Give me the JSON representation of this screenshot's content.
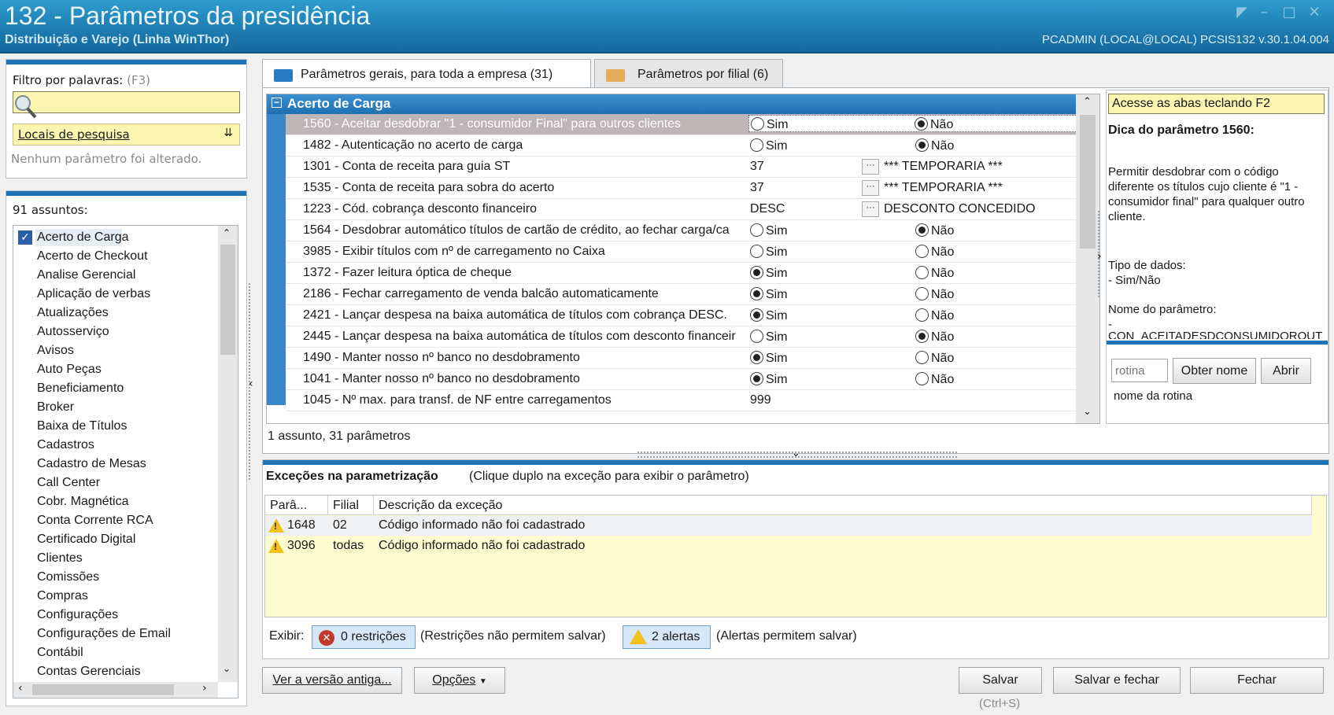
{
  "window": {
    "title": "132 - Parâmetros da presidência",
    "subtitle": "Distribuição e Varejo (Linha WinThor)",
    "user_info": "PCADMIN (LOCAL@LOCAL)   PCSIS132  v.30.1.04.004"
  },
  "filter": {
    "label": "Filtro por palavras:",
    "shortcut": "(F3)",
    "search_value": "",
    "locations_label": "Locais de pesquisa",
    "no_changes": "Nenhum parâmetro foi alterado."
  },
  "subjects": {
    "count_label": "91 assuntos:",
    "items": [
      "Acerto de Carga",
      "Acerto de Checkout",
      "Analise Gerencial",
      "Aplicação de verbas",
      "Atualizações",
      "Autosserviço",
      "Avisos",
      "Auto Peças",
      "Beneficiamento",
      "Broker",
      "Baixa de Títulos",
      "Cadastros",
      "Cadastro de Mesas",
      "Call Center",
      "Cobr. Magnética",
      "Conta Corrente RCA",
      "Certificado Digital",
      "Clientes",
      "Comissões",
      "Compras",
      "Configurações",
      "Configurações de Email",
      "Contábil",
      "Contas Gerenciais"
    ]
  },
  "tabs": [
    {
      "label": "Parâmetros gerais, para toda a empresa  (31)"
    },
    {
      "label": "Parâmetros por filial  (6)"
    }
  ],
  "grid": {
    "group": "Acerto de Carga",
    "rows": [
      {
        "label": "1560 - Aceitar desdobrar \"1 - consumidor Final\" para outros clientes",
        "type": "bool",
        "sim": false,
        "nao": true
      },
      {
        "label": "1482 - Autenticação no acerto de carga",
        "type": "bool",
        "sim": false,
        "nao": true
      },
      {
        "label": "1301 - Conta de receita para guia ST",
        "type": "lookup",
        "value": "37",
        "desc": "*** TEMPORARIA ***"
      },
      {
        "label": "1535 - Conta de receita para sobra do acerto",
        "type": "lookup",
        "value": "37",
        "desc": "*** TEMPORARIA ***"
      },
      {
        "label": "1223 - Cód. cobrança desconto financeiro",
        "type": "lookup",
        "value": "DESC",
        "desc": "DESCONTO CONCEDIDO"
      },
      {
        "label": "1564 - Desdobrar automático títulos de cartão de crédito, ao fechar carga/ca",
        "type": "bool",
        "sim": false,
        "nao": true
      },
      {
        "label": "3985 - Exibir títulos com nº de carregamento no Caixa",
        "type": "bool",
        "sim": false,
        "nao": false
      },
      {
        "label": "1372 - Fazer leitura óptica de cheque",
        "type": "bool",
        "sim": true,
        "nao": false
      },
      {
        "label": "2186 - Fechar carregamento de venda balcão automaticamente",
        "type": "bool",
        "sim": true,
        "nao": false
      },
      {
        "label": "2421 - Lançar despesa na baixa automática de títulos com cobrança DESC.",
        "type": "bool",
        "sim": true,
        "nao": false
      },
      {
        "label": "2445 - Lançar despesa na baixa automática de títulos com desconto financeir",
        "type": "bool",
        "sim": false,
        "nao": true
      },
      {
        "label": "1490 - Manter nosso nº banco no desdobramento",
        "type": "bool",
        "sim": true,
        "nao": false
      },
      {
        "label": "1041 - Manter nosso nº banco no desdobramento",
        "type": "bool",
        "sim": true,
        "nao": false
      },
      {
        "label": "1045 - Nº max. para transf. de NF entre carregamentos",
        "type": "text",
        "value": "999"
      }
    ],
    "sim_label": "Sim",
    "nao_label": "Não",
    "status": "1 assunto, 31 parâmetros"
  },
  "tip": {
    "tab_hint": "Acesse as abas teclando F2",
    "title": "Dica do parâmetro 1560:",
    "body": "Permitir desdobrar com o código diferente os títulos cujo cliente é \"1 - consumidor final\" para qualquer outro cliente.",
    "data_type_label": "Tipo de dados:",
    "data_type_value": "- Sim/Não",
    "param_name_label": "Nome do parâmetro:",
    "param_name_dash": "-",
    "param_name_value": "CON_ACEITADESDCONSUMIDOROUT",
    "routine_placeholder": "rotina",
    "get_name_button": "Obter nome",
    "open_button": "Abrir",
    "routine_name": "nome da rotina"
  },
  "exceptions": {
    "title": "Exceções na parametrização",
    "hint": "(Clique duplo na exceção para exibir o parâmetro)",
    "columns": [
      "Parâ...",
      "Filial",
      "Descrição da exceção"
    ],
    "rows": [
      {
        "param": "1648",
        "filial": "02",
        "desc": "Código informado não foi cadastrado"
      },
      {
        "param": "3096",
        "filial": "todas",
        "desc": "Código informado não foi cadastrado"
      }
    ],
    "show_label": "Exibir:",
    "restrictions_button": "0 restrições",
    "restrictions_note": "(Restrições não permitem salvar)",
    "alerts_button": "2 alertas",
    "alerts_note": "(Alertas permitem salvar)"
  },
  "footer": {
    "old_version": "Ver a versão antiga...",
    "options": "Opções",
    "save": "Salvar",
    "save_shortcut": "(Ctrl+S)",
    "save_close": "Salvar e fechar",
    "close": "Fechar"
  },
  "colors": {
    "accent": "#1f74b8",
    "highlight": "#fbf5b0",
    "selected_row": "#bfb4b6",
    "warning": "#f3c21a"
  }
}
